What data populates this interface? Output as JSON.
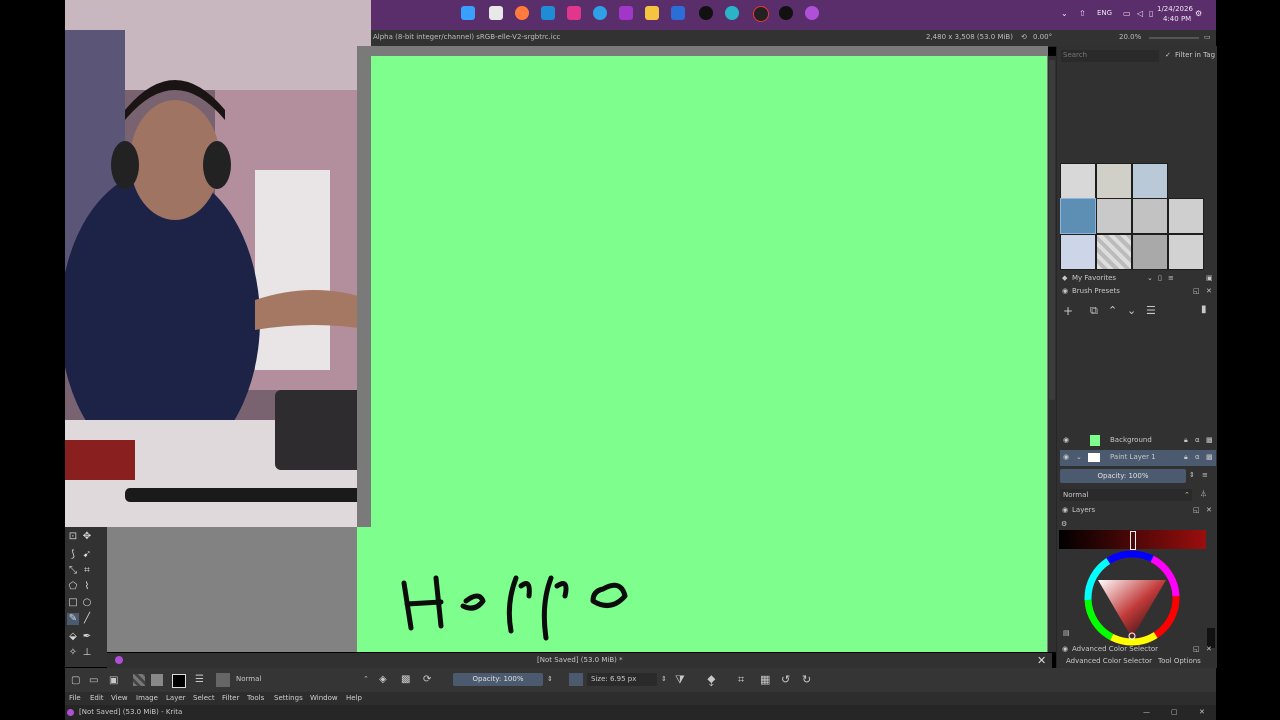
{
  "taskbar": {
    "tray": {
      "lang": "ENG",
      "time": "4:40 PM",
      "date": "1/24/2026"
    }
  },
  "document": {
    "info_left": "Alpha (8-bit integer/channel) sRGB-elle-V2-srgbtrc.icc",
    "info_right_size": "2,480 x 3,508 (53.0 MiB)",
    "rotation": "0.00°",
    "zoom": "20.0%",
    "status": "[Not Saved] (53.0 MiB) *"
  },
  "canvas": {
    "text": "Hello",
    "background_color": "#7dfe8d"
  },
  "docker": {
    "search_placeholder": "Search",
    "filter_label": "Filter in Tag",
    "brush_tag": "My Favorites",
    "brush_presets_title": "Brush Presets",
    "layers": [
      {
        "name": "Background",
        "color": "#7dfe8d"
      },
      {
        "name": "Paint Layer 1",
        "color": "#ffffff"
      }
    ],
    "layer_opacity": "Opacity: 100%",
    "blend_mode": "Normal",
    "layers_title": "Layers",
    "color_selector_title": "Advanced Color Selector",
    "tabs": [
      "Advanced Color Selector",
      "Tool Options"
    ]
  },
  "tool_options": {
    "blend_mode": "Normal",
    "opacity": "Opacity: 100%",
    "size": "Size: 6.95 px"
  },
  "menu": [
    "File",
    "Edit",
    "View",
    "Image",
    "Layer",
    "Select",
    "Filter",
    "Tools",
    "Settings",
    "Window",
    "Help"
  ],
  "titlebar": {
    "title": "[Not Saved] (53.0 MiB) - Krita"
  },
  "colors": {
    "accent": "#5a2d6b",
    "canvas": "#7dfe8d",
    "panel": "#313131",
    "highlight": "#4b5a6e"
  }
}
